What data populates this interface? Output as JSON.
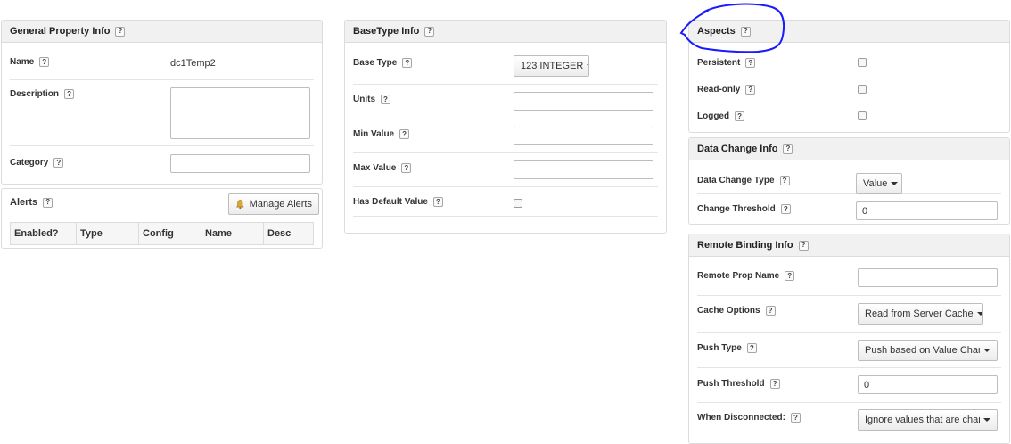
{
  "general": {
    "title": "General Property Info",
    "name_label": "Name",
    "name_value": "dc1Temp2",
    "description_label": "Description",
    "description_value": "",
    "category_label": "Category",
    "category_value": ""
  },
  "alerts": {
    "title": "Alerts",
    "manage_label": "Manage Alerts",
    "columns": [
      "Enabled?",
      "Type",
      "Config",
      "Name",
      "Desc"
    ]
  },
  "basetype": {
    "title": "BaseType Info",
    "base_type_label": "Base Type",
    "base_type_value": "123 INTEGER",
    "units_label": "Units",
    "min_label": "Min Value",
    "max_label": "Max Value",
    "default_label": "Has Default Value"
  },
  "aspects": {
    "title": "Aspects",
    "persistent_label": "Persistent",
    "readonly_label": "Read-only",
    "logged_label": "Logged"
  },
  "datachange": {
    "title": "Data Change Info",
    "type_label": "Data Change Type",
    "type_value": "Value",
    "threshold_label": "Change Threshold",
    "threshold_value": "0"
  },
  "remote": {
    "title": "Remote Binding Info",
    "prop_name_label": "Remote Prop Name",
    "prop_name_value": "",
    "cache_label": "Cache Options",
    "cache_value": "Read from Server Cache",
    "push_type_label": "Push Type",
    "push_type_value": "Push based on Value Chang...",
    "push_threshold_label": "Push Threshold",
    "push_threshold_value": "0",
    "disconnected_label": "When Disconnected:",
    "disconnected_value": "Ignore values that are chan..."
  },
  "help_glyph": "?",
  "annotation_color": "#1a1aff",
  "icons": {
    "help": "question-box-icon",
    "bell": "bell-icon",
    "dropdown": "caret-down-icon"
  }
}
